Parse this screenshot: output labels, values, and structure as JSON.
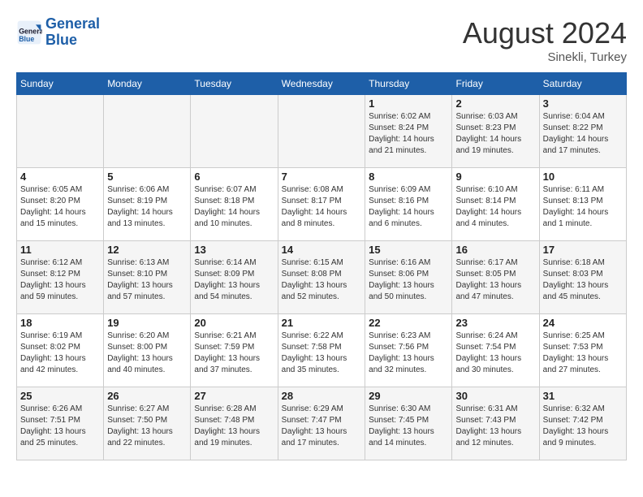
{
  "header": {
    "logo_line1": "General",
    "logo_line2": "Blue",
    "month_year": "August 2024",
    "location": "Sinekli, Turkey"
  },
  "days_of_week": [
    "Sunday",
    "Monday",
    "Tuesday",
    "Wednesday",
    "Thursday",
    "Friday",
    "Saturday"
  ],
  "weeks": [
    [
      {
        "day": "",
        "info": ""
      },
      {
        "day": "",
        "info": ""
      },
      {
        "day": "",
        "info": ""
      },
      {
        "day": "",
        "info": ""
      },
      {
        "day": "1",
        "info": "Sunrise: 6:02 AM\nSunset: 8:24 PM\nDaylight: 14 hours and 21 minutes."
      },
      {
        "day": "2",
        "info": "Sunrise: 6:03 AM\nSunset: 8:23 PM\nDaylight: 14 hours and 19 minutes."
      },
      {
        "day": "3",
        "info": "Sunrise: 6:04 AM\nSunset: 8:22 PM\nDaylight: 14 hours and 17 minutes."
      }
    ],
    [
      {
        "day": "4",
        "info": "Sunrise: 6:05 AM\nSunset: 8:20 PM\nDaylight: 14 hours and 15 minutes."
      },
      {
        "day": "5",
        "info": "Sunrise: 6:06 AM\nSunset: 8:19 PM\nDaylight: 14 hours and 13 minutes."
      },
      {
        "day": "6",
        "info": "Sunrise: 6:07 AM\nSunset: 8:18 PM\nDaylight: 14 hours and 10 minutes."
      },
      {
        "day": "7",
        "info": "Sunrise: 6:08 AM\nSunset: 8:17 PM\nDaylight: 14 hours and 8 minutes."
      },
      {
        "day": "8",
        "info": "Sunrise: 6:09 AM\nSunset: 8:16 PM\nDaylight: 14 hours and 6 minutes."
      },
      {
        "day": "9",
        "info": "Sunrise: 6:10 AM\nSunset: 8:14 PM\nDaylight: 14 hours and 4 minutes."
      },
      {
        "day": "10",
        "info": "Sunrise: 6:11 AM\nSunset: 8:13 PM\nDaylight: 14 hours and 1 minute."
      }
    ],
    [
      {
        "day": "11",
        "info": "Sunrise: 6:12 AM\nSunset: 8:12 PM\nDaylight: 13 hours and 59 minutes."
      },
      {
        "day": "12",
        "info": "Sunrise: 6:13 AM\nSunset: 8:10 PM\nDaylight: 13 hours and 57 minutes."
      },
      {
        "day": "13",
        "info": "Sunrise: 6:14 AM\nSunset: 8:09 PM\nDaylight: 13 hours and 54 minutes."
      },
      {
        "day": "14",
        "info": "Sunrise: 6:15 AM\nSunset: 8:08 PM\nDaylight: 13 hours and 52 minutes."
      },
      {
        "day": "15",
        "info": "Sunrise: 6:16 AM\nSunset: 8:06 PM\nDaylight: 13 hours and 50 minutes."
      },
      {
        "day": "16",
        "info": "Sunrise: 6:17 AM\nSunset: 8:05 PM\nDaylight: 13 hours and 47 minutes."
      },
      {
        "day": "17",
        "info": "Sunrise: 6:18 AM\nSunset: 8:03 PM\nDaylight: 13 hours and 45 minutes."
      }
    ],
    [
      {
        "day": "18",
        "info": "Sunrise: 6:19 AM\nSunset: 8:02 PM\nDaylight: 13 hours and 42 minutes."
      },
      {
        "day": "19",
        "info": "Sunrise: 6:20 AM\nSunset: 8:00 PM\nDaylight: 13 hours and 40 minutes."
      },
      {
        "day": "20",
        "info": "Sunrise: 6:21 AM\nSunset: 7:59 PM\nDaylight: 13 hours and 37 minutes."
      },
      {
        "day": "21",
        "info": "Sunrise: 6:22 AM\nSunset: 7:58 PM\nDaylight: 13 hours and 35 minutes."
      },
      {
        "day": "22",
        "info": "Sunrise: 6:23 AM\nSunset: 7:56 PM\nDaylight: 13 hours and 32 minutes."
      },
      {
        "day": "23",
        "info": "Sunrise: 6:24 AM\nSunset: 7:54 PM\nDaylight: 13 hours and 30 minutes."
      },
      {
        "day": "24",
        "info": "Sunrise: 6:25 AM\nSunset: 7:53 PM\nDaylight: 13 hours and 27 minutes."
      }
    ],
    [
      {
        "day": "25",
        "info": "Sunrise: 6:26 AM\nSunset: 7:51 PM\nDaylight: 13 hours and 25 minutes."
      },
      {
        "day": "26",
        "info": "Sunrise: 6:27 AM\nSunset: 7:50 PM\nDaylight: 13 hours and 22 minutes."
      },
      {
        "day": "27",
        "info": "Sunrise: 6:28 AM\nSunset: 7:48 PM\nDaylight: 13 hours and 19 minutes."
      },
      {
        "day": "28",
        "info": "Sunrise: 6:29 AM\nSunset: 7:47 PM\nDaylight: 13 hours and 17 minutes."
      },
      {
        "day": "29",
        "info": "Sunrise: 6:30 AM\nSunset: 7:45 PM\nDaylight: 13 hours and 14 minutes."
      },
      {
        "day": "30",
        "info": "Sunrise: 6:31 AM\nSunset: 7:43 PM\nDaylight: 13 hours and 12 minutes."
      },
      {
        "day": "31",
        "info": "Sunrise: 6:32 AM\nSunset: 7:42 PM\nDaylight: 13 hours and 9 minutes."
      }
    ]
  ]
}
